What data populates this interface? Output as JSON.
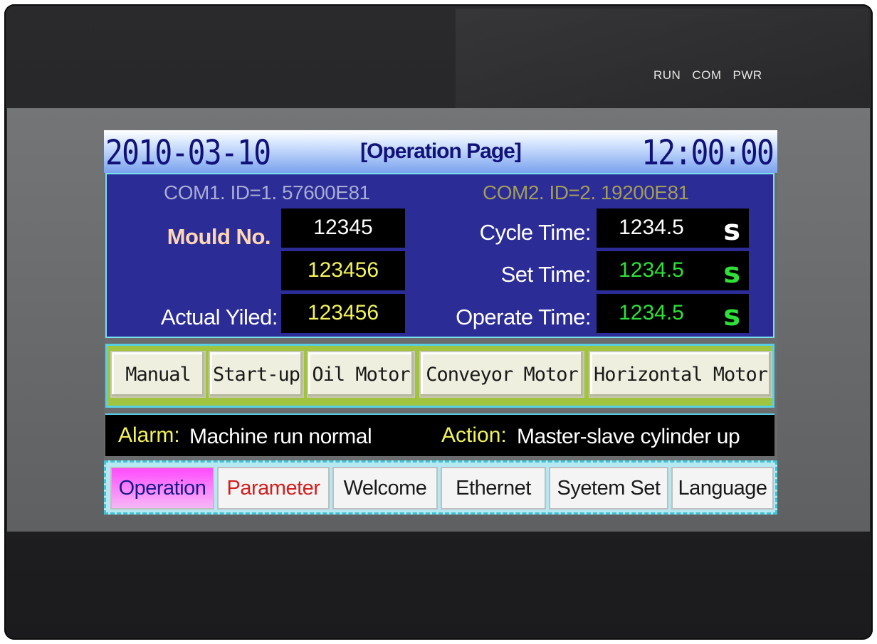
{
  "device": {
    "indicators": [
      "RUN",
      "COM",
      "PWR"
    ]
  },
  "screen": {
    "date": "2010-03-10",
    "page_title": "[Operation Page]",
    "time": "12:00:00",
    "com1": "COM1. ID=1. 57600E81",
    "com2": "COM2. ID=2. 19200E81",
    "left_fields": {
      "mould_label": "Mould No.",
      "mould_value": "12345",
      "second_value": "123456",
      "yield_label": "Actual Yiled:",
      "yield_value": "123456"
    },
    "right_fields": {
      "cycle_label": "Cycle Time:",
      "cycle_value": "1234.5",
      "set_label": "Set Time:",
      "set_value": "1234.5",
      "operate_label": "Operate Time:",
      "operate_value": "1234.5",
      "unit": "s"
    },
    "function_buttons": [
      "Manual",
      "Start-up",
      "Oil Motor",
      "Conveyor Motor",
      "Horizontal Motor"
    ],
    "alarm_label": "Alarm:",
    "alarm_text": "Machine run normal",
    "action_label": "Action:",
    "action_text": "Master-slave cylinder up",
    "nav_tabs": [
      "Operation",
      "Parameter",
      "Welcome",
      "Ethernet",
      "Syetem Set",
      "Language"
    ]
  },
  "colors": {
    "panel_blue": "#2c2c96",
    "value_yellow": "#f3f35a",
    "value_green": "#2fe03a",
    "button_panel_green": "#a0c440",
    "active_tab_magenta": "#ff4cff",
    "parameter_red": "#d21e1e"
  }
}
